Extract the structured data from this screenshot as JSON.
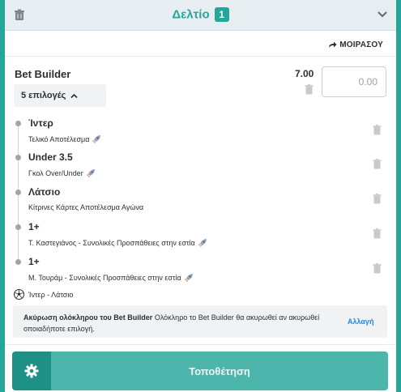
{
  "header": {
    "title": "Δελτίο",
    "count": "1"
  },
  "share": {
    "label": "ΜΟΙΡΑΣΟΥ"
  },
  "bet_builder": {
    "title": "Bet Builder",
    "selections_toggle": "5 επιλογές",
    "odds": "7.00",
    "stake_placeholder": "0.00"
  },
  "selections": [
    {
      "name": "Ίντερ",
      "market": "Τελικό Αποτέλεσμα",
      "boost": true
    },
    {
      "name": "Under 3.5",
      "market": "Γκολ Over/Under",
      "boost": true
    },
    {
      "name": "Λάτσιο",
      "market": "Κίτρινες Κάρτες Αποτέλεσμα Αγώνα",
      "boost": false
    },
    {
      "name": "1+",
      "market": "Τ. Καστεγιάνος - Συνολικές Προσπάθειες στην εστία",
      "boost": true
    },
    {
      "name": "1+",
      "market": "Μ. Τουράμ - Συνολικές Προσπάθειες στην εστία",
      "boost": true
    }
  ],
  "event": {
    "label": "Ίντερ - Λάτσιο",
    "icon": "soccer-ball-icon"
  },
  "notice": {
    "bold": "Ακύρωση ολόκληρου του Bet Builder",
    "text": " Ολόκληρο το Bet Builder θα ακυρωθεί αν ακυρωθεί οποιαδήποτε επιλογή.",
    "link": "Αλλαγή"
  },
  "place": {
    "label": "Τοποθέτηση"
  },
  "colors": {
    "accent": "#26a69a",
    "place_button": "#4db6ac",
    "link": "#1e88e5"
  }
}
